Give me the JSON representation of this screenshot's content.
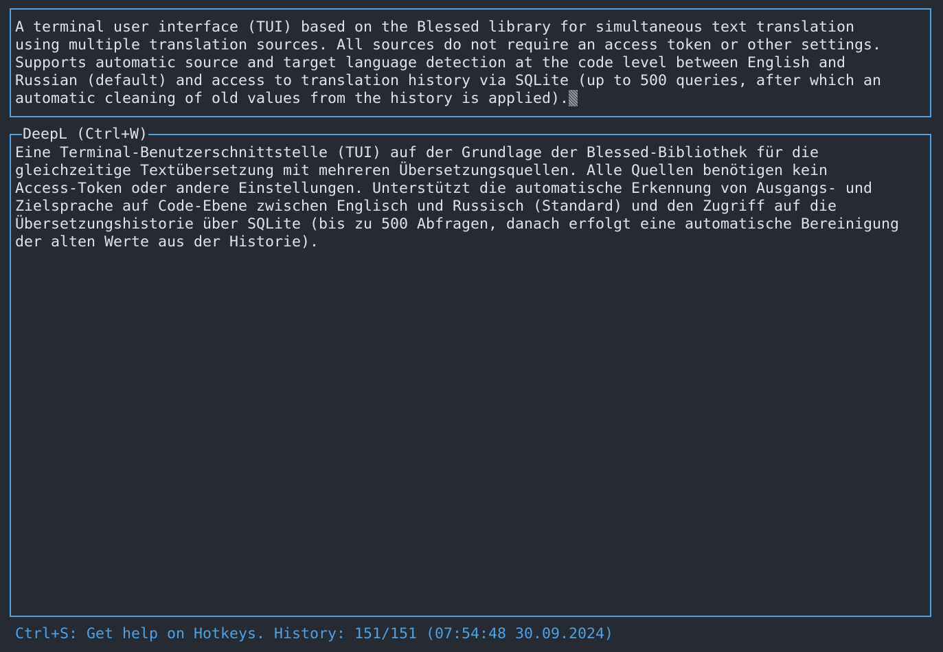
{
  "input_panel": {
    "lines": [
      "A terminal user interface (TUI) based on the Blessed library for simultaneous text translation",
      "using multiple translation sources. All sources do not require an access token or other settings.",
      "Supports automatic source and target language detection at the code level between English and",
      "Russian (default) and access to translation history via SQLite (up to 500 queries, after which an",
      "automatic cleaning of old values from the history is applied)."
    ]
  },
  "output_panel": {
    "title": "DeepL (Ctrl+W)",
    "lines": [
      "Eine Terminal-Benutzerschnittstelle (TUI) auf der Grundlage der Blessed-Bibliothek für die",
      "gleichzeitige Textübersetzung mit mehreren Übersetzungsquellen. Alle Quellen benötigen kein",
      "Access-Token oder andere Einstellungen. Unterstützt die automatische Erkennung von Ausgangs- und",
      "Zielsprache auf Code-Ebene zwischen Englisch und Russisch (Standard) und den Zugriff auf die",
      "Übersetzungshistorie über SQLite (bis zu 500 Abfragen, danach erfolgt eine automatische Bereinigung",
      "der alten Werte aus der Historie)."
    ]
  },
  "status_bar": {
    "text": "Ctrl+S: Get help on Hotkeys. History: 151/151 (07:54:48 30.09.2024)"
  },
  "colors": {
    "background": "#262a33",
    "border": "#4ea1e4",
    "text": "#dfe2e7",
    "status_text": "#4ea1e4"
  }
}
